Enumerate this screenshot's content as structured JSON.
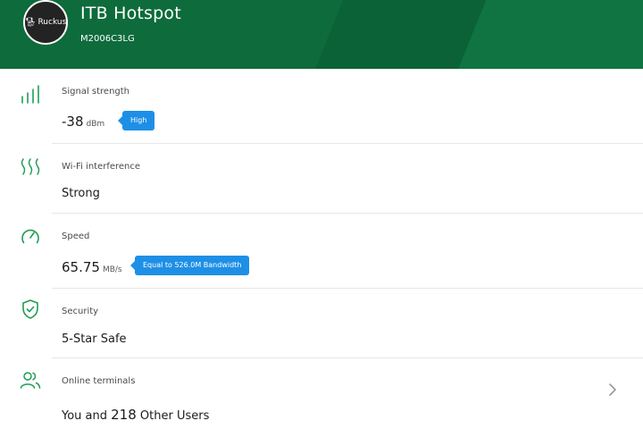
{
  "header": {
    "logo_text": "Ruckus",
    "title": "ITB Hotspot",
    "subtitle": "M2006C3LG"
  },
  "rows": {
    "signal": {
      "label": "Signal strength",
      "value": "-38",
      "unit": "dBm",
      "badge": "High"
    },
    "interference": {
      "label": "Wi-Fi interference",
      "value": "Strong"
    },
    "speed": {
      "label": "Speed",
      "value": "65.75",
      "unit": "MB/s",
      "badge": "Equal to 526.0M Bandwidth"
    },
    "security": {
      "label": "Security",
      "value": "5-Star Safe"
    },
    "terminals": {
      "label": "Online terminals",
      "prefix": "You and",
      "count": "218",
      "suffix": "Other Users"
    }
  },
  "icons": {
    "signal": "signal-bars-icon",
    "interference": "wavy-lines-icon",
    "speed": "speedometer-icon",
    "security": "shield-check-icon",
    "terminals": "users-icon",
    "chevron": "chevron-right-icon"
  },
  "colors": {
    "header_bg": "#0d6b3c",
    "accent": "#1f9d55",
    "badge": "#1e8fe6"
  }
}
